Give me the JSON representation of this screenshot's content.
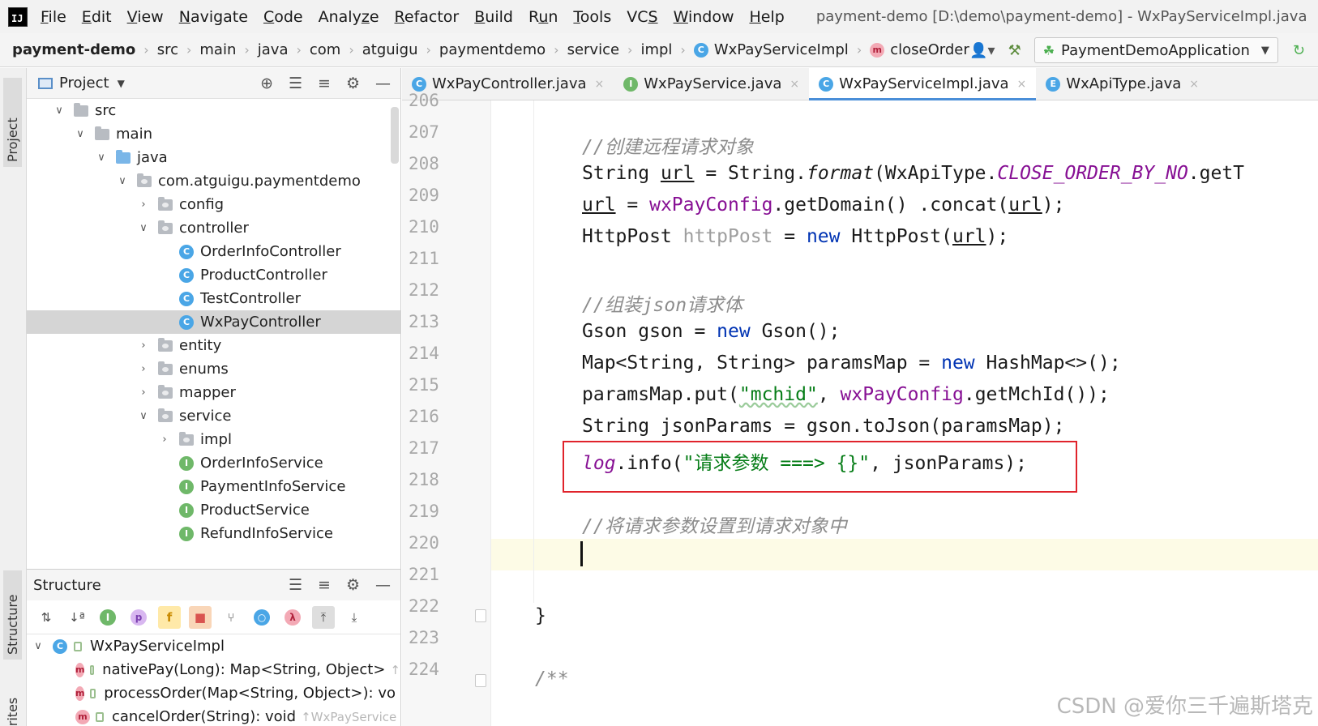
{
  "menubar": {
    "logo": "IJ",
    "items": [
      {
        "pre": "",
        "mn": "F",
        "post": "ile"
      },
      {
        "pre": "",
        "mn": "E",
        "post": "dit"
      },
      {
        "pre": "",
        "mn": "V",
        "post": "iew"
      },
      {
        "pre": "",
        "mn": "N",
        "post": "avigate"
      },
      {
        "pre": "",
        "mn": "C",
        "post": "ode"
      },
      {
        "pre": "Analy",
        "mn": "z",
        "post": "e"
      },
      {
        "pre": "",
        "mn": "R",
        "post": "efactor"
      },
      {
        "pre": "",
        "mn": "B",
        "post": "uild"
      },
      {
        "pre": "R",
        "mn": "u",
        "post": "n"
      },
      {
        "pre": "",
        "mn": "T",
        "post": "ools"
      },
      {
        "pre": "VC",
        "mn": "S",
        "post": ""
      },
      {
        "pre": "",
        "mn": "W",
        "post": "indow"
      },
      {
        "pre": "",
        "mn": "H",
        "post": "elp"
      }
    ],
    "window_title": "payment-demo [D:\\demo\\payment-demo] - WxPayServiceImpl.java"
  },
  "navbar": {
    "project": "payment-demo",
    "crumbs": [
      "src",
      "main",
      "java",
      "com",
      "atguigu",
      "paymentdemo",
      "service",
      "impl"
    ],
    "class_badge": "C",
    "class_name": "WxPayServiceImpl",
    "method_badge": "m",
    "method_name": "closeOrder",
    "run_config": "PaymentDemoApplication"
  },
  "left_strip": {
    "project_tab": "Project",
    "structure_tab": "Structure",
    "favorites_tab": "orites"
  },
  "project_panel": {
    "title": "Project",
    "tree": [
      {
        "label": "src",
        "depth": 0,
        "arrow": "open",
        "icon": "folder"
      },
      {
        "label": "main",
        "depth": 1,
        "arrow": "open",
        "icon": "folder"
      },
      {
        "label": "java",
        "depth": 2,
        "arrow": "open",
        "icon": "folder-blue"
      },
      {
        "label": "com.atguigu.paymentdemo",
        "depth": 3,
        "arrow": "open",
        "icon": "package"
      },
      {
        "label": "config",
        "depth": 4,
        "arrow": "closed",
        "icon": "package"
      },
      {
        "label": "controller",
        "depth": 4,
        "arrow": "open",
        "icon": "package"
      },
      {
        "label": "OrderInfoController",
        "depth": 5,
        "arrow": "none",
        "icon": "class"
      },
      {
        "label": "ProductController",
        "depth": 5,
        "arrow": "none",
        "icon": "class"
      },
      {
        "label": "TestController",
        "depth": 5,
        "arrow": "none",
        "icon": "class"
      },
      {
        "label": "WxPayController",
        "depth": 5,
        "arrow": "none",
        "icon": "class",
        "selected": true
      },
      {
        "label": "entity",
        "depth": 4,
        "arrow": "closed",
        "icon": "package"
      },
      {
        "label": "enums",
        "depth": 4,
        "arrow": "closed",
        "icon": "package"
      },
      {
        "label": "mapper",
        "depth": 4,
        "arrow": "closed",
        "icon": "package"
      },
      {
        "label": "service",
        "depth": 4,
        "arrow": "open",
        "icon": "package"
      },
      {
        "label": "impl",
        "depth": 5,
        "arrow": "closed",
        "icon": "package"
      },
      {
        "label": "OrderInfoService",
        "depth": 5,
        "arrow": "none",
        "icon": "interface"
      },
      {
        "label": "PaymentInfoService",
        "depth": 5,
        "arrow": "none",
        "icon": "interface"
      },
      {
        "label": "ProductService",
        "depth": 5,
        "arrow": "none",
        "icon": "interface"
      },
      {
        "label": "RefundInfoService",
        "depth": 5,
        "arrow": "none",
        "icon": "interface"
      }
    ]
  },
  "structure_panel": {
    "title": "Structure",
    "root": "WxPayServiceImpl",
    "members": [
      {
        "badge": "m",
        "text": "nativePay(Long): Map<String, Object>",
        "hint": "↑"
      },
      {
        "badge": "m",
        "text": "processOrder(Map<String, Object>): vo",
        "hint": ""
      },
      {
        "badge": "m",
        "text": "cancelOrder(String): void",
        "hint": "↑WxPayService"
      }
    ]
  },
  "editor": {
    "tabs": [
      {
        "badge": "C",
        "label": "WxPayController.java",
        "active": false
      },
      {
        "badge": "I",
        "label": "WxPayService.java",
        "active": false
      },
      {
        "badge": "C",
        "label": "WxPayServiceImpl.java",
        "active": true
      },
      {
        "badge": "E",
        "label": "WxApiType.java",
        "active": false
      }
    ],
    "line_numbers": [
      "206",
      "207",
      "208",
      "209",
      "210",
      "211",
      "212",
      "213",
      "214",
      "215",
      "216",
      "217",
      "218",
      "219",
      "220",
      "221",
      "222",
      "223",
      "224"
    ],
    "code": {
      "l207": "//创建远程请求对象",
      "l208_a": "String ",
      "l208_b": "url",
      "l208_c": " = String.",
      "l208_d": "format",
      "l208_e": "(WxApiType.",
      "l208_f": "CLOSE_ORDER_BY_NO",
      "l208_g": ".getT",
      "l209_a": "url",
      "l209_b": " = ",
      "l209_c": "wxPayConfig",
      "l209_d": ".getDomain() .concat(",
      "l209_e": "url",
      "l209_f": ");",
      "l210_a": "HttpPost ",
      "l210_b": "httpPost",
      "l210_c": " = ",
      "l210_d": "new",
      "l210_e": " HttpPost(",
      "l210_f": "url",
      "l210_g": ");",
      "l212": "//组装json请求体",
      "l213_a": "Gson gson = ",
      "l213_b": "new",
      "l213_c": " Gson();",
      "l214_a": "Map<String, String> paramsMap = ",
      "l214_b": "new",
      "l214_c": " HashMap<>();",
      "l215_a": "paramsMap.put(",
      "l215_b": "\"mchid\"",
      "l215_c": ", ",
      "l215_d": "wxPayConfig",
      "l215_e": ".getMchId());",
      "l216": "String jsonParams = gson.toJson(paramsMap);",
      "l217_a": "log",
      "l217_b": ".info(",
      "l217_c": "\"请求参数 ===> {}\"",
      "l217_d": ", jsonParams);",
      "l219": "//将请求参数设置到请求对象中",
      "l222": "}",
      "l224": "/**"
    }
  },
  "watermark": "CSDN @爱你三千遍斯塔克",
  "colors": {
    "keyword": "#0033b3",
    "field": "#871094",
    "string": "#067d17",
    "comment": "#8c8c8c",
    "highlight_box": "#e0232b",
    "active_tab_underline": "#4a8ed8"
  }
}
